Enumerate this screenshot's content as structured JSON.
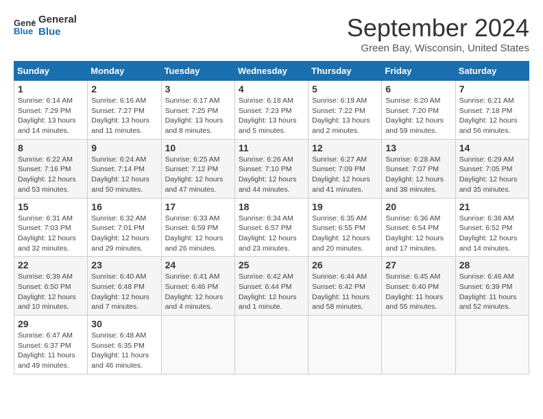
{
  "logo": {
    "text_general": "General",
    "text_blue": "Blue"
  },
  "header": {
    "month_year": "September 2024",
    "location": "Green Bay, Wisconsin, United States"
  },
  "weekdays": [
    "Sunday",
    "Monday",
    "Tuesday",
    "Wednesday",
    "Thursday",
    "Friday",
    "Saturday"
  ],
  "weeks": [
    [
      {
        "day": "1",
        "info": "Sunrise: 6:14 AM\nSunset: 7:29 PM\nDaylight: 13 hours\nand 14 minutes."
      },
      {
        "day": "2",
        "info": "Sunrise: 6:16 AM\nSunset: 7:27 PM\nDaylight: 13 hours\nand 11 minutes."
      },
      {
        "day": "3",
        "info": "Sunrise: 6:17 AM\nSunset: 7:25 PM\nDaylight: 13 hours\nand 8 minutes."
      },
      {
        "day": "4",
        "info": "Sunrise: 6:18 AM\nSunset: 7:23 PM\nDaylight: 13 hours\nand 5 minutes."
      },
      {
        "day": "5",
        "info": "Sunrise: 6:19 AM\nSunset: 7:22 PM\nDaylight: 13 hours\nand 2 minutes."
      },
      {
        "day": "6",
        "info": "Sunrise: 6:20 AM\nSunset: 7:20 PM\nDaylight: 12 hours\nand 59 minutes."
      },
      {
        "day": "7",
        "info": "Sunrise: 6:21 AM\nSunset: 7:18 PM\nDaylight: 12 hours\nand 56 minutes."
      }
    ],
    [
      {
        "day": "8",
        "info": "Sunrise: 6:22 AM\nSunset: 7:16 PM\nDaylight: 12 hours\nand 53 minutes."
      },
      {
        "day": "9",
        "info": "Sunrise: 6:24 AM\nSunset: 7:14 PM\nDaylight: 12 hours\nand 50 minutes."
      },
      {
        "day": "10",
        "info": "Sunrise: 6:25 AM\nSunset: 7:12 PM\nDaylight: 12 hours\nand 47 minutes."
      },
      {
        "day": "11",
        "info": "Sunrise: 6:26 AM\nSunset: 7:10 PM\nDaylight: 12 hours\nand 44 minutes."
      },
      {
        "day": "12",
        "info": "Sunrise: 6:27 AM\nSunset: 7:09 PM\nDaylight: 12 hours\nand 41 minutes."
      },
      {
        "day": "13",
        "info": "Sunrise: 6:28 AM\nSunset: 7:07 PM\nDaylight: 12 hours\nand 38 minutes."
      },
      {
        "day": "14",
        "info": "Sunrise: 6:29 AM\nSunset: 7:05 PM\nDaylight: 12 hours\nand 35 minutes."
      }
    ],
    [
      {
        "day": "15",
        "info": "Sunrise: 6:31 AM\nSunset: 7:03 PM\nDaylight: 12 hours\nand 32 minutes."
      },
      {
        "day": "16",
        "info": "Sunrise: 6:32 AM\nSunset: 7:01 PM\nDaylight: 12 hours\nand 29 minutes."
      },
      {
        "day": "17",
        "info": "Sunrise: 6:33 AM\nSunset: 6:59 PM\nDaylight: 12 hours\nand 26 minutes."
      },
      {
        "day": "18",
        "info": "Sunrise: 6:34 AM\nSunset: 6:57 PM\nDaylight: 12 hours\nand 23 minutes."
      },
      {
        "day": "19",
        "info": "Sunrise: 6:35 AM\nSunset: 6:55 PM\nDaylight: 12 hours\nand 20 minutes."
      },
      {
        "day": "20",
        "info": "Sunrise: 6:36 AM\nSunset: 6:54 PM\nDaylight: 12 hours\nand 17 minutes."
      },
      {
        "day": "21",
        "info": "Sunrise: 6:38 AM\nSunset: 6:52 PM\nDaylight: 12 hours\nand 14 minutes."
      }
    ],
    [
      {
        "day": "22",
        "info": "Sunrise: 6:39 AM\nSunset: 6:50 PM\nDaylight: 12 hours\nand 10 minutes."
      },
      {
        "day": "23",
        "info": "Sunrise: 6:40 AM\nSunset: 6:48 PM\nDaylight: 12 hours\nand 7 minutes."
      },
      {
        "day": "24",
        "info": "Sunrise: 6:41 AM\nSunset: 6:46 PM\nDaylight: 12 hours\nand 4 minutes."
      },
      {
        "day": "25",
        "info": "Sunrise: 6:42 AM\nSunset: 6:44 PM\nDaylight: 12 hours\nand 1 minute."
      },
      {
        "day": "26",
        "info": "Sunrise: 6:44 AM\nSunset: 6:42 PM\nDaylight: 11 hours\nand 58 minutes."
      },
      {
        "day": "27",
        "info": "Sunrise: 6:45 AM\nSunset: 6:40 PM\nDaylight: 11 hours\nand 55 minutes."
      },
      {
        "day": "28",
        "info": "Sunrise: 6:46 AM\nSunset: 6:39 PM\nDaylight: 11 hours\nand 52 minutes."
      }
    ],
    [
      {
        "day": "29",
        "info": "Sunrise: 6:47 AM\nSunset: 6:37 PM\nDaylight: 11 hours\nand 49 minutes."
      },
      {
        "day": "30",
        "info": "Sunrise: 6:48 AM\nSunset: 6:35 PM\nDaylight: 11 hours\nand 46 minutes."
      },
      {
        "day": "",
        "info": ""
      },
      {
        "day": "",
        "info": ""
      },
      {
        "day": "",
        "info": ""
      },
      {
        "day": "",
        "info": ""
      },
      {
        "day": "",
        "info": ""
      }
    ]
  ]
}
